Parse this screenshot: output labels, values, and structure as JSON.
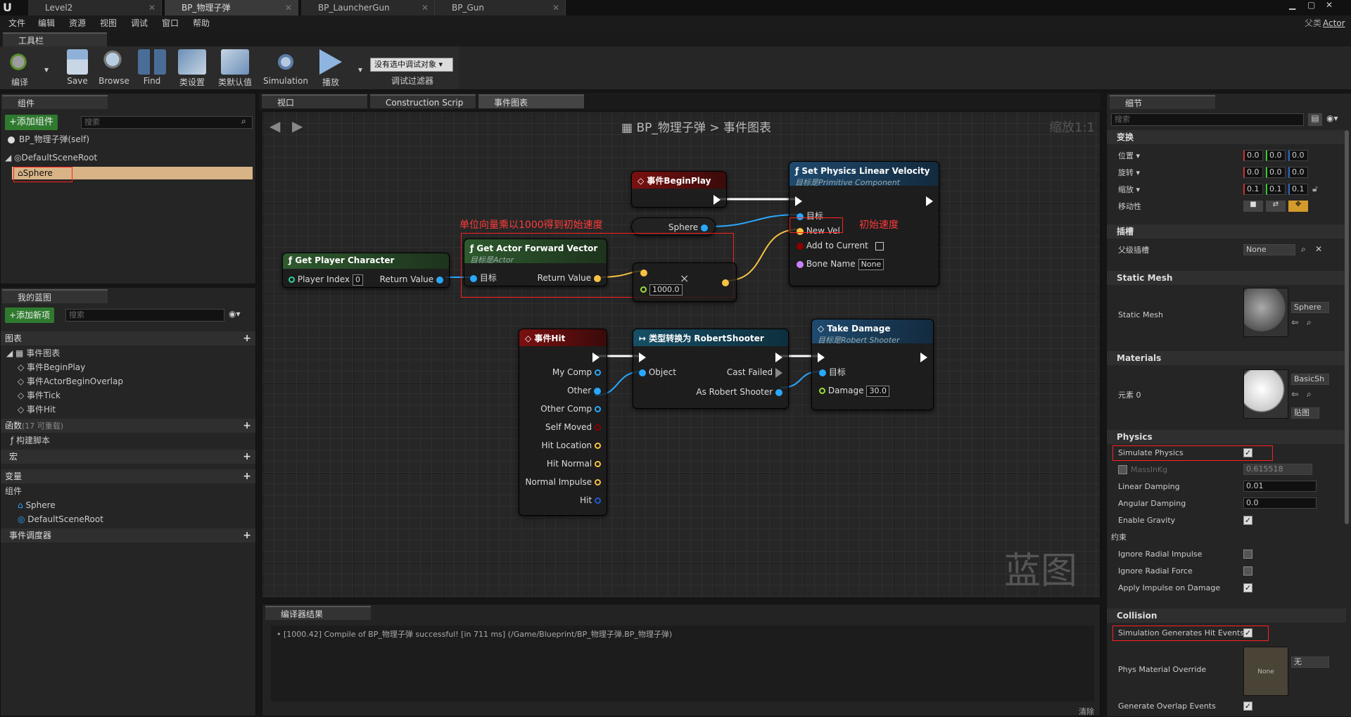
{
  "window": {
    "doc_tabs": [
      "Level2",
      "BP_物理子弹",
      "BP_LauncherGun",
      "BP_Gun"
    ],
    "parent_label": "父类",
    "parent_value": "Actor"
  },
  "menu": [
    "文件",
    "编辑",
    "资源",
    "视图",
    "调试",
    "窗口",
    "帮助"
  ],
  "toolbar": {
    "tab": "工具栏",
    "buttons": [
      "编译",
      "Save",
      "Browse",
      "Find",
      "类设置",
      "类默认值",
      "Simulation",
      "播放"
    ],
    "debug_select": "没有选中调试对象",
    "debug_filter": "调试过滤器"
  },
  "components": {
    "tab": "组件",
    "add_button": "+添加组件",
    "search_placeholder": "搜索",
    "items": [
      "BP_物理子弹(self)",
      "DefaultSceneRoot",
      "Sphere"
    ]
  },
  "my_blueprint": {
    "tab": "我的蓝图",
    "add_button": "+添加新项",
    "search_placeholder": "搜索",
    "graphs_header": "图表",
    "event_graph": "事件图表",
    "events": [
      "事件BeginPlay",
      "事件ActorBeginOverlap",
      "事件Tick",
      "事件Hit"
    ],
    "functions_header": "函数",
    "functions_count": "(17 可重载)",
    "construction": "构建脚本",
    "macros_header": "宏",
    "variables_header": "变量",
    "components_header": "组件",
    "variables": [
      "Sphere",
      "DefaultSceneRoot"
    ],
    "dispatchers_header": "事件调度器"
  },
  "editor_tabs": [
    "视口",
    "Construction Scrip",
    "事件图表"
  ],
  "graph": {
    "breadcrumb_bp": "BP_物理子弹",
    "breadcrumb_sep": ">",
    "breadcrumb_graph": "事件图表",
    "zoom": "缩放1:1",
    "watermark": "蓝图",
    "nodes": {
      "begin_play": {
        "title": "事件BeginPlay"
      },
      "set_velocity": {
        "title": "Set Physics Linear Velocity",
        "subtitle": "目标是Primitive Component",
        "pins": [
          "目标",
          "New Vel",
          "Add to Current",
          "Bone Name"
        ],
        "bone_value": "None"
      },
      "sphere_var": {
        "label": "Sphere"
      },
      "get_player": {
        "title": "Get Player Character",
        "pin_in": "Player Index",
        "pin_in_value": "0",
        "pin_out": "Return Value"
      },
      "forward_vec": {
        "title": "Get Actor Forward Vector",
        "subtitle": "目标是Actor",
        "pin_in": "目标",
        "pin_out": "Return Value"
      },
      "multiply": {
        "value": "1000.0"
      },
      "event_hit": {
        "title": "事件Hit",
        "pins": [
          "My Comp",
          "Other",
          "Other Comp",
          "Self Moved",
          "Hit Location",
          "Hit Normal",
          "Normal Impulse",
          "Hit"
        ]
      },
      "cast": {
        "title": "类型转换为 RobertShooter",
        "pin_in": "Object",
        "pin_fail": "Cast Failed",
        "pin_out": "As Robert Shooter"
      },
      "take_damage": {
        "title": "Take Damage",
        "subtitle": "目标是Robert Shooter",
        "pins": [
          "目标",
          "Damage"
        ],
        "damage_value": "30.0"
      }
    },
    "annotations": {
      "vector_note": "单位向量乘以1000得到初始速度",
      "vel_note": "初始速度"
    }
  },
  "compiler": {
    "tab": "编译器结果",
    "message": "[1000.42] Compile of BP_物理子弹 successful! [in 711 ms] (/Game/Blueprint/BP_物理子弹.BP_物理子弹)",
    "clear": "清除"
  },
  "details": {
    "tab": "细节",
    "search_placeholder": "搜索",
    "transform": {
      "header": "变换",
      "location": "位置",
      "rotation": "旋转",
      "scale": "缩放",
      "mobility": "移动性",
      "loc_vals": [
        "0.0",
        "0.0",
        "0.0"
      ],
      "rot_vals": [
        "0.0",
        "0.0",
        "0.0"
      ],
      "scale_vals": [
        "0.1",
        "0.1",
        "0.1"
      ]
    },
    "sockets": {
      "header": "插槽",
      "parent_socket": "父级插槽",
      "value": "None"
    },
    "static_mesh": {
      "header": "Static Mesh",
      "label": "Static Mesh",
      "value": "Sphere"
    },
    "materials": {
      "header": "Materials",
      "label": "元素 0",
      "value": "BasicSh",
      "btn": "贴图"
    },
    "physics": {
      "header": "Physics",
      "simulate": "Simulate Physics",
      "mass": "MassInKg",
      "mass_value": "0.615518",
      "linear_damping": "Linear Damping",
      "linear_value": "0.01",
      "angular_damping": "Angular Damping",
      "angular_value": "0.0",
      "enable_gravity": "Enable Gravity",
      "constraints": "约束",
      "ignore_radial_impulse": "Ignore Radial Impulse",
      "ignore_radial_force": "Ignore Radial Force",
      "apply_impulse": "Apply Impulse on Damage"
    },
    "collision": {
      "header": "Collision",
      "sim_hit": "Simulation Generates Hit Events",
      "phys_mat": "Phys Material Override",
      "phys_mat_value": "None",
      "phys_mat_select": "无",
      "gen_overlap": "Generate Overlap Events"
    }
  },
  "colors": {
    "event_red": "#7a1010",
    "func_blue": "#1f4a6e",
    "pure_green": "#2e5a2e",
    "cast_teal": "#164f66",
    "exec": "#ffffff",
    "object_pin": "#29a8ff",
    "vector_pin": "#f6c244",
    "annotation": "#ff2f2f"
  }
}
